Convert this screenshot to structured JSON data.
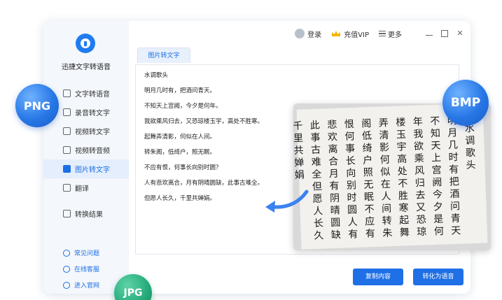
{
  "app": {
    "name": "迅捷文字转语音"
  },
  "topbar": {
    "login": "登录",
    "vip": "充值VIP",
    "more": "更多"
  },
  "nav": [
    {
      "label": "文字转语音",
      "icon": "text-icon"
    },
    {
      "label": "录音转文字",
      "icon": "recorder-icon"
    },
    {
      "label": "视频转文字",
      "icon": "video-icon"
    },
    {
      "label": "视频转音频",
      "icon": "video-audio-icon"
    },
    {
      "label": "图片转文字",
      "icon": "image-icon",
      "active": true
    },
    {
      "label": "翻译",
      "icon": "translate-icon"
    },
    {
      "label": "转换结果",
      "icon": "result-icon"
    }
  ],
  "help": [
    {
      "label": "常见问题",
      "icon": "question-icon"
    },
    {
      "label": "在线客服",
      "icon": "headset-icon"
    },
    {
      "label": "进入官网",
      "icon": "monitor-icon"
    }
  ],
  "tab": {
    "label": "图片转文字"
  },
  "poem": [
    "水调歌头",
    "明月几时有，把酒问青天。",
    "不知天上宫阙，今夕是何年。",
    "我欲乘风归去，又恐琼楼玉宇，高处不胜寒。",
    "起舞弄清影，何似在人间。",
    "转朱阁，低绮户，照无眠。",
    "不应有恨，何事长向别时圆？",
    "人有悲欢离合，月有阴晴圆缺，此事古难全。",
    "但愿人长久，千里共婵娟。"
  ],
  "buttons": {
    "copy": "复制内容",
    "convert": "转化为语音"
  },
  "badges": {
    "png": "PNG",
    "bmp": "BMP",
    "jpg": "JPG"
  },
  "calligraphy_columns": [
    "水调歌头",
    "明月几时有把酒问青天",
    "不知天上宫阙今夕是何",
    "年我欲乘风归去又恐琼",
    "楼玉宇高处不胜寒起舞",
    "弄清影何似在人间转朱",
    "阁低绮户照无眠不应有",
    "恨何事长向别时圆人有",
    "悲欢离合月有阴晴圆缺",
    "此事古难全但愿人长久",
    "千里共婵娟"
  ],
  "colors": {
    "accent": "#1f6fe6",
    "jpg_badge": "#23a979"
  }
}
